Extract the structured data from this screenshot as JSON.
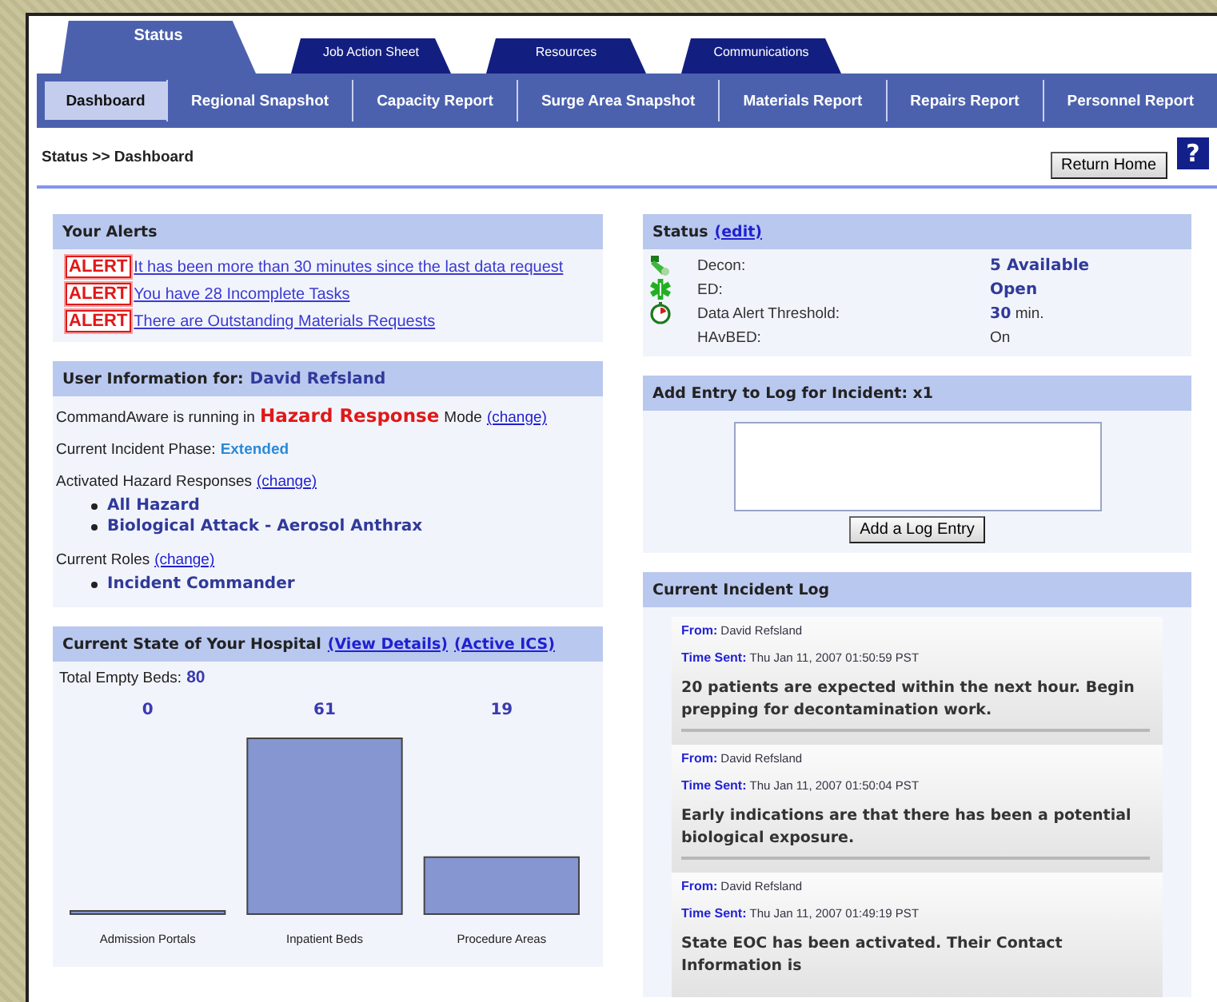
{
  "top_tabs": [
    {
      "label": "Status",
      "selected": true
    },
    {
      "label": "Job Action Sheet",
      "selected": false
    },
    {
      "label": "Resources",
      "selected": false
    },
    {
      "label": "Communications",
      "selected": false
    }
  ],
  "sub_tabs": [
    {
      "label": "Dashboard",
      "selected": true
    },
    {
      "label": "Regional Snapshot",
      "selected": false
    },
    {
      "label": "Capacity Report",
      "selected": false
    },
    {
      "label": "Surge Area Snapshot",
      "selected": false
    },
    {
      "label": "Materials Report",
      "selected": false
    },
    {
      "label": "Repairs Report",
      "selected": false
    },
    {
      "label": "Personnel Report",
      "selected": false
    }
  ],
  "breadcrumb": "Status >> Dashboard",
  "return_button": "Return Home",
  "help_button": "?",
  "alerts": {
    "title": "Your Alerts",
    "items": [
      {
        "badge": "ALERT",
        "text": "It has been more than 30 minutes since the last data request"
      },
      {
        "badge": "ALERT",
        "text": "You have 28 Incomplete Tasks"
      },
      {
        "badge": "ALERT",
        "text": "There are Outstanding Materials Requests"
      }
    ]
  },
  "user_info": {
    "title_label": "User Information for:",
    "user": "David Refsland",
    "mode_prefix": "CommandAware is running in",
    "mode": "Hazard Response",
    "mode_suffix": "Mode",
    "mode_link": "(change)",
    "phase_label": "Current Incident Phase:",
    "phase": "Extended",
    "hazards_label": "Activated Hazard Responses",
    "hazards_link": "(change)",
    "hazards": [
      "All Hazard",
      "Biological Attack - Aerosol Anthrax"
    ],
    "roles_label": "Current Roles",
    "roles_link": "(change)",
    "roles": [
      "Incident Commander"
    ]
  },
  "hospital": {
    "title": "Current State of Your Hospital",
    "links": [
      "(View Details)",
      "(Active ICS)"
    ],
    "total_label": "Total Empty Beds:",
    "total": "80",
    "chart_data": {
      "type": "bar",
      "categories": [
        "Admission Portals",
        "Inpatient Beds",
        "Procedure Areas"
      ],
      "values": [
        0,
        61,
        19
      ],
      "data_labels": true
    }
  },
  "status": {
    "title": "Status",
    "edit_link": "(edit)",
    "rows": [
      {
        "kind": "decon",
        "label": "Decon:",
        "value": "5 Available",
        "bold": true
      },
      {
        "kind": "ed",
        "label": "ED:",
        "value": "Open",
        "bold": true
      },
      {
        "kind": "timer",
        "label": "Data Alert Threshold:",
        "value": "**30** min.",
        "bold": false
      },
      {
        "kind": "plain",
        "label": "HAvBED:",
        "value": "On",
        "bold": false
      }
    ]
  },
  "log_entry": {
    "title": "Add Entry to Log for Incident: x1",
    "button": "Add a Log Entry"
  },
  "incident_log": {
    "title": "Current Incident Log",
    "entries": [
      {
        "from_label": "From:",
        "from": "David Refsland",
        "time_label": "Time Sent:",
        "time": "Thu Jan 11, 2007 01:50:59 PST",
        "message": "20 patients are expected within the next hour. Begin prepping for decontamination work."
      },
      {
        "from_label": "From:",
        "from": "David Refsland",
        "time_label": "Time Sent:",
        "time": "Thu Jan 11, 2007 01:50:04 PST",
        "message": "Early indications are that there has been a potential biological exposure."
      },
      {
        "from_label": "From:",
        "from": "David Refsland",
        "time_label": "Time Sent:",
        "time": "Thu Jan 11, 2007 01:49:19 PST",
        "message": "State EOC has been activated. Their Contact Information is"
      }
    ]
  }
}
